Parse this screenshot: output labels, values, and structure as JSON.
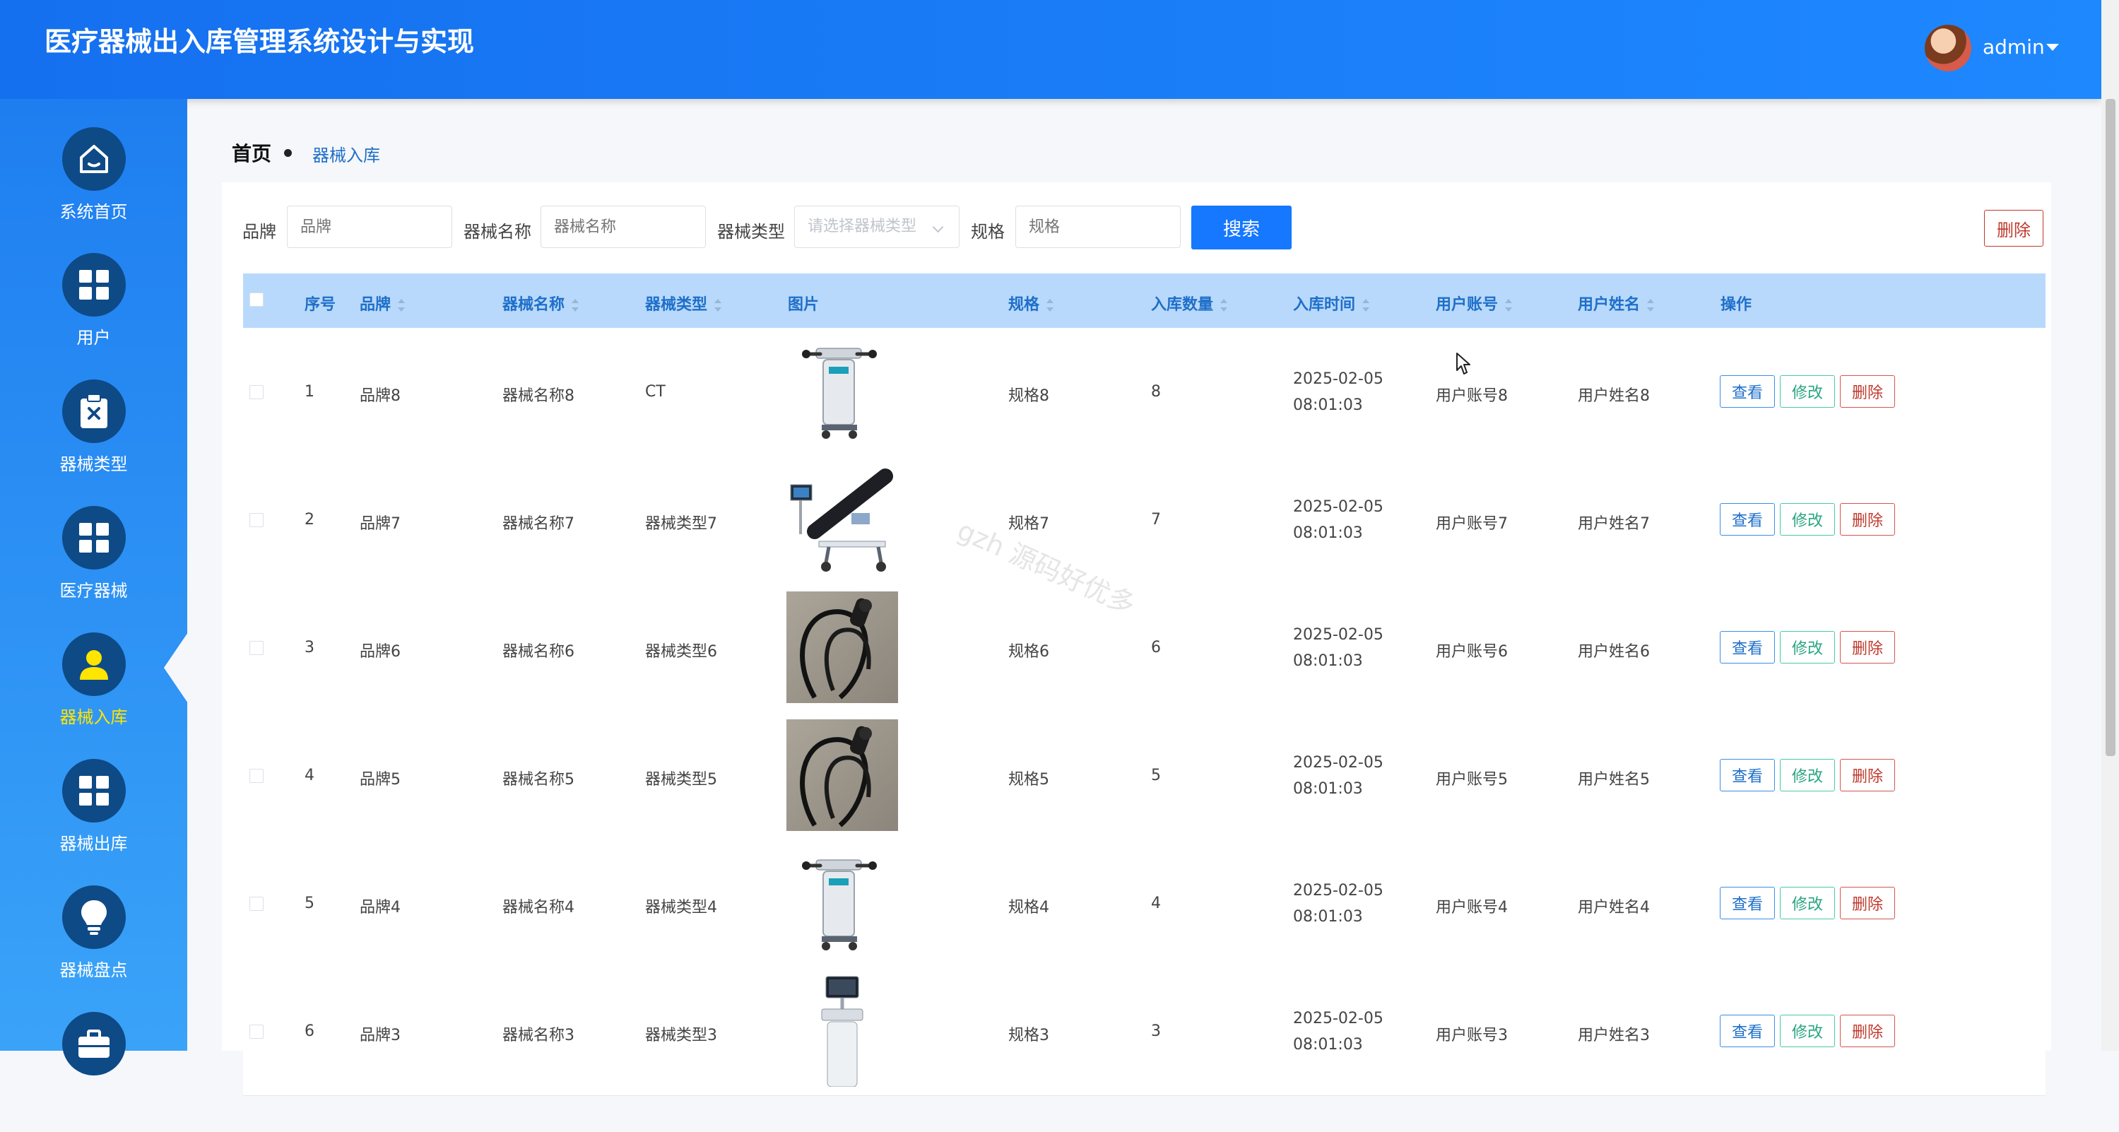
{
  "header": {
    "title": "医疗器械出入库管理系统设计与实现",
    "user": "admin"
  },
  "sidebar": {
    "items": [
      {
        "label": "系统首页",
        "icon": "home-icon"
      },
      {
        "label": "用户",
        "icon": "grid-icon"
      },
      {
        "label": "器械类型",
        "icon": "clipboard-icon"
      },
      {
        "label": "医疗器械",
        "icon": "grid-icon"
      },
      {
        "label": "器械入库",
        "icon": "user-icon",
        "active": true
      },
      {
        "label": "器械出库",
        "icon": "grid-icon"
      },
      {
        "label": "器械盘点",
        "icon": "bulb-icon"
      },
      {
        "label": "",
        "icon": "briefcase-icon"
      }
    ],
    "active_color": "#ffe500"
  },
  "breadcrumb": {
    "home": "首页",
    "current": "器械入库"
  },
  "search": {
    "brand_label": "品牌",
    "brand_placeholder": "品牌",
    "name_label": "器械名称",
    "name_placeholder": "器械名称",
    "type_label": "器械类型",
    "type_placeholder": "请选择器械类型",
    "spec_label": "规格",
    "spec_placeholder": "规格",
    "search_button": "搜索",
    "delete_button": "删除"
  },
  "table": {
    "columns": [
      "序号",
      "品牌",
      "器械名称",
      "器械类型",
      "图片",
      "规格",
      "入库数量",
      "入库时间",
      "用户账号",
      "用户姓名",
      "操作"
    ],
    "rows": [
      {
        "no": "1",
        "brand": "品牌8",
        "name": "器械名称8",
        "type": "CT",
        "spec": "规格8",
        "qty": "8",
        "time": "2025-02-05 08:01:03",
        "account": "用户账号8",
        "username": "用户姓名8",
        "image": "treadmill-cart"
      },
      {
        "no": "2",
        "brand": "品牌7",
        "name": "器械名称7",
        "type": "器械类型7",
        "spec": "规格7",
        "qty": "7",
        "time": "2025-02-05 08:01:03",
        "account": "用户账号7",
        "username": "用户姓名7",
        "image": "rehab-bed"
      },
      {
        "no": "3",
        "brand": "品牌6",
        "name": "器械名称6",
        "type": "器械类型6",
        "spec": "规格6",
        "qty": "6",
        "time": "2025-02-05 08:01:03",
        "account": "用户账号6",
        "username": "用户姓名6",
        "image": "endoscope"
      },
      {
        "no": "4",
        "brand": "品牌5",
        "name": "器械名称5",
        "type": "器械类型5",
        "spec": "规格5",
        "qty": "5",
        "time": "2025-02-05 08:01:03",
        "account": "用户账号5",
        "username": "用户姓名5",
        "image": "endoscope"
      },
      {
        "no": "5",
        "brand": "品牌4",
        "name": "器械名称4",
        "type": "器械类型4",
        "spec": "规格4",
        "qty": "4",
        "time": "2025-02-05 08:01:03",
        "account": "用户账号4",
        "username": "用户姓名4",
        "image": "treadmill-cart"
      },
      {
        "no": "6",
        "brand": "品牌3",
        "name": "器械名称3",
        "type": "器械类型3",
        "spec": "规格3",
        "qty": "3",
        "time": "2025-02-05 08:01:03",
        "account": "用户账号3",
        "username": "用户姓名3",
        "image": "ultrasound"
      }
    ],
    "ops": {
      "view": "查看",
      "edit": "修改",
      "delete": "删除"
    }
  },
  "watermark": "gzh 源码好优多"
}
